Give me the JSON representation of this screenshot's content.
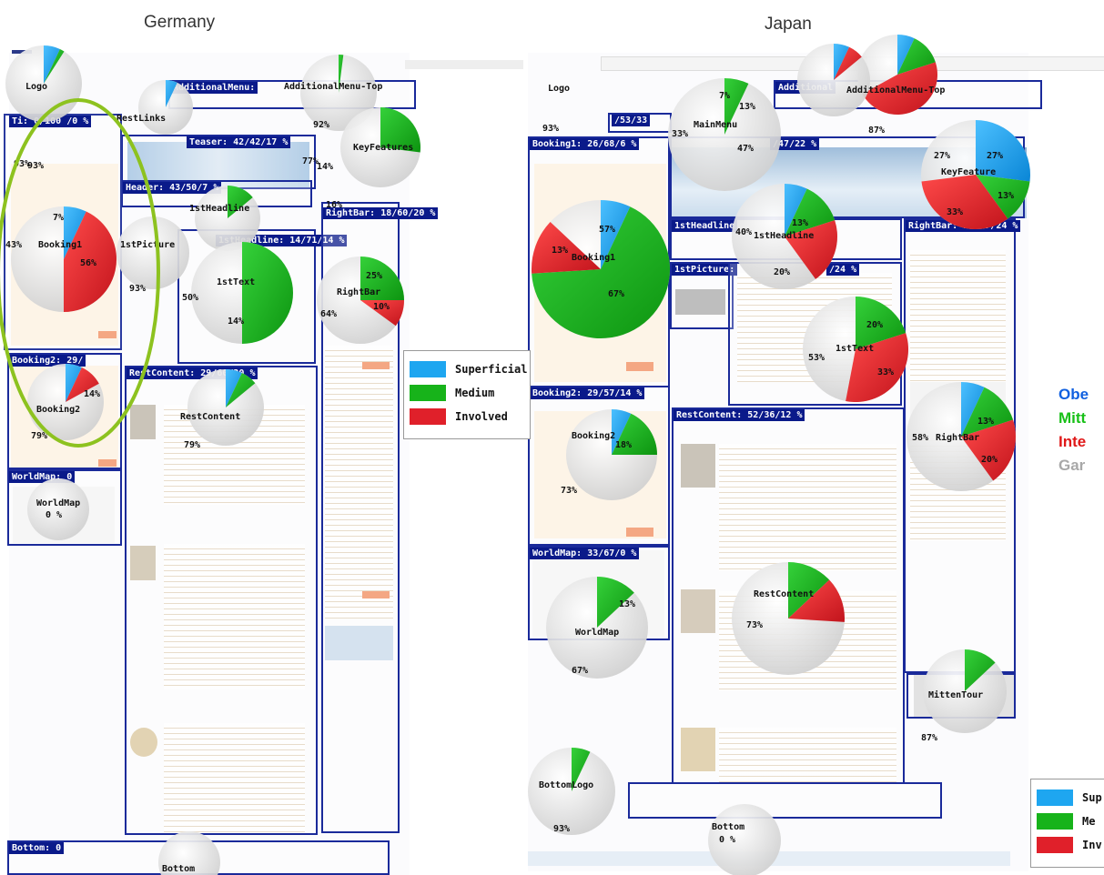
{
  "columns": {
    "germany": "Germany",
    "japan": "Japan"
  },
  "colors": {
    "superficial": "#1ea6f0",
    "medium": "#17b31a",
    "involved": "#e0202a",
    "gaze_off": "#bdbdbd",
    "highlight_ring": "#8dc21f",
    "region_border": "#1a2a9a"
  },
  "legend_main": [
    "Superficial",
    "Medium",
    "Involved"
  ],
  "legend_small": [
    "Sup",
    "Me",
    "Inv"
  ],
  "side_labels": [
    "Obe",
    "Mitt",
    "Inte",
    "Gar"
  ],
  "germany_regions": [
    {
      "label": "AdditionalMenu: "
    },
    {
      "label": "Teaser: 42/42/17 %"
    },
    {
      "label": "Header: 43/50/7 %"
    },
    {
      "label": "1stHeadline: 14/71/14 %"
    },
    {
      "label": "RightBar: 18/60/20 %"
    },
    {
      "label": "Booking2: 29/"
    },
    {
      "label": "RestContent: 29/60/20 %"
    },
    {
      "label": "WorldMap: 0"
    },
    {
      "label": "Bottom: 0"
    },
    {
      "label": "Ti: 0/100 /0 %"
    }
  ],
  "germany_pies": [
    {
      "name": "Logo",
      "slices": [
        7,
        2,
        0
      ]
    },
    {
      "name": "AdditionalMenu-Top",
      "slices": [
        0,
        2,
        0
      ]
    },
    {
      "name": "RestLinks",
      "slices": [
        7,
        0,
        0
      ]
    },
    {
      "name": "KeyFeatures",
      "slices": [
        0,
        27,
        0
      ]
    },
    {
      "name": "Booking1",
      "slices": [
        7,
        0,
        43
      ]
    },
    {
      "name": "1stPicture",
      "slices": [
        0,
        0,
        0
      ]
    },
    {
      "name": "1stHeadline",
      "slices": [
        0,
        14,
        0
      ]
    },
    {
      "name": "1stText",
      "slices": [
        0,
        50,
        0
      ]
    },
    {
      "name": "RightBar",
      "slices": [
        0,
        25,
        10
      ]
    },
    {
      "name": "Booking2",
      "slices": [
        7,
        0,
        10
      ]
    },
    {
      "name": "RestContent",
      "slices": [
        7,
        7,
        0
      ]
    },
    {
      "name": "WorldMap",
      "slices": [
        0,
        0,
        0
      ]
    },
    {
      "name": "Bottom",
      "slices": [
        0,
        0,
        0
      ]
    }
  ],
  "germany_texts": [
    "Logo",
    "93%",
    "AdditionalMenu-Top",
    "92%",
    "RestLinks",
    "KeyFeatures",
    "77%",
    "14%",
    "16%",
    "Booking1",
    "43%",
    "56%",
    "7%",
    "1stPicture",
    "93%",
    "1stHeadline",
    "1stText",
    "50%",
    "14%",
    "RightBar",
    "25%",
    "10%",
    "64%",
    "Booking2",
    "14%",
    "79%",
    "RestContent",
    "79%",
    "WorldMap",
    "0 %",
    "Bottom",
    "0 %",
    "93%"
  ],
  "japan_regions": [
    {
      "label": "Additional"
    },
    {
      "label": "/53/33"
    },
    {
      "label": "Booking1: 26/68/6 %"
    },
    {
      "label": "/47/22 %"
    },
    {
      "label": "1stHeadline"
    },
    {
      "label": "1stPicture:"
    },
    {
      "label": "/24 %"
    },
    {
      "label": "RightBar: 19/57/24 %"
    },
    {
      "label": "Booking2: 29/57/14 %"
    },
    {
      "label": "RestContent: 52/36/12 %"
    },
    {
      "label": "WorldMap: 33/67/0 %"
    }
  ],
  "japan_pies": [
    {
      "name": "Logo",
      "slices": [
        0,
        7,
        0
      ]
    },
    {
      "name": "MainMenu",
      "slices": [
        7,
        13,
        47
      ]
    },
    {
      "name": "AdditionalMenu-Top",
      "slices": [
        7,
        0,
        7
      ]
    },
    {
      "name": "KeyFeature",
      "slices": [
        27,
        13,
        33
      ]
    },
    {
      "name": "1stHeadline",
      "slices": [
        7,
        13,
        20
      ]
    },
    {
      "name": "Booking1",
      "slices": [
        7,
        67,
        13
      ]
    },
    {
      "name": "1stText",
      "slices": [
        0,
        20,
        33
      ]
    },
    {
      "name": "Booking2",
      "slices": [
        7,
        18,
        0
      ]
    },
    {
      "name": "RightBar",
      "slices": [
        7,
        13,
        20
      ]
    },
    {
      "name": "RestContent",
      "slices": [
        0,
        13,
        13
      ]
    },
    {
      "name": "WorldMap",
      "slices": [
        0,
        13,
        0
      ]
    },
    {
      "name": "MittenTour",
      "slices": [
        0,
        13,
        0
      ]
    },
    {
      "name": "BottomLogo",
      "slices": [
        0,
        7,
        0
      ]
    },
    {
      "name": "Bottom",
      "slices": [
        0,
        0,
        0
      ]
    }
  ],
  "japan_texts": [
    "Logo",
    "93%",
    "MainMenu",
    "33%",
    "47%",
    "13%",
    "7%",
    "AdditionalMenu-Top",
    "87%",
    "KeyFeature",
    "27%",
    "27%",
    "13%",
    "33%",
    "1stHeadline",
    "40%",
    "20%",
    "13%",
    "Booking1",
    "67%",
    "13%",
    "57%",
    "1stText",
    "53%",
    "20%",
    "33%",
    "Booking2",
    "18%",
    "73%",
    "RightBar",
    "58%",
    "13%",
    "20%",
    "RestContent",
    "73%",
    "WorldMap",
    "67%",
    "13%",
    "MittenTour",
    "87%",
    "BottomLogo",
    "93%",
    "Bottom",
    "0 %"
  ]
}
